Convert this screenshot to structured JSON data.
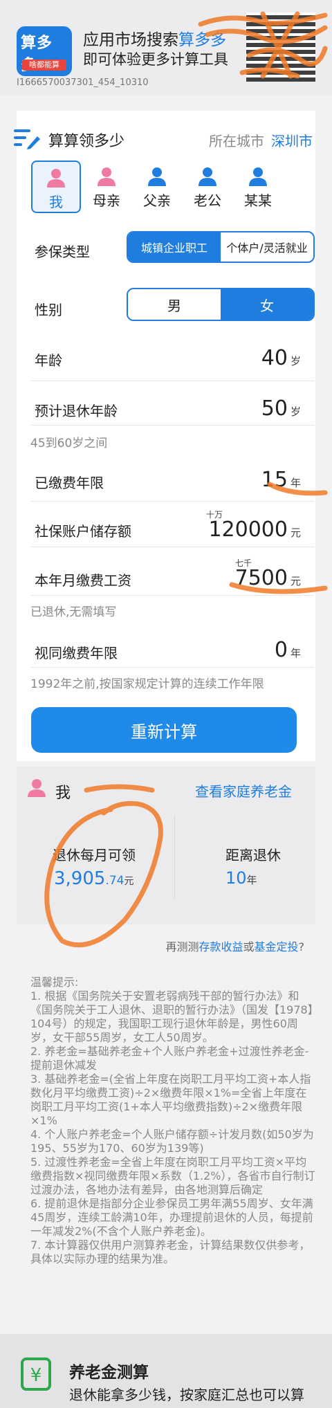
{
  "banner": {
    "title_prefix": "应用市场搜索",
    "title_highlight": "算多多",
    "subtitle": "即可体验更多计算工具",
    "id": "I1666570037301_454_10310",
    "app_icon_text": "算多多",
    "app_icon_tag": "啥都能算"
  },
  "header": {
    "title": "算算领多少",
    "city_label": "所在城市",
    "city_value": "深圳市",
    "icon": "list-pen-icon"
  },
  "persons": [
    {
      "label": "我",
      "selected": true,
      "color": "#f07aa0"
    },
    {
      "label": "母亲",
      "selected": false,
      "color": "#f07aa0"
    },
    {
      "label": "父亲",
      "selected": false,
      "color": "#1f7de0"
    },
    {
      "label": "老公",
      "selected": false,
      "color": "#1f7de0"
    },
    {
      "label": "某某",
      "selected": false,
      "color": "#1f7de0"
    }
  ],
  "form": {
    "insurance_type": {
      "label": "参保类型",
      "options": [
        "城镇企业职工",
        "个体户/灵活就业"
      ],
      "selected": 0
    },
    "gender": {
      "label": "性别",
      "options": [
        "男",
        "女"
      ],
      "selected": 1
    },
    "age": {
      "label": "年龄",
      "value": "40",
      "unit": "岁"
    },
    "retire_age": {
      "label": "预计退休年龄",
      "value": "50",
      "unit": "岁",
      "hint": "45到60岁之间"
    },
    "paid_years": {
      "label": "已缴费年限",
      "value": "15",
      "unit": "年"
    },
    "account_balance": {
      "label": "社保账户储存额",
      "value": "120000",
      "unit": "元",
      "magnitude": "十万"
    },
    "monthly_wage": {
      "label": "本年月缴费工资",
      "value": "7500",
      "unit": "元",
      "magnitude": "七千",
      "hint": "已退休,无需填写"
    },
    "deemed_years": {
      "label": "视同缴费年限",
      "value": "0",
      "unit": "年",
      "hint": "1992年之前,按国家规定计算的连续工作年限"
    }
  },
  "recalc_button": "重新计算",
  "result": {
    "name": "我",
    "family_link": "查看家庭养老金",
    "monthly_label": "退休每月可领",
    "monthly_value": "3,905",
    "monthly_decimal": ".74",
    "monthly_unit": "元",
    "distance_label": "距离退休",
    "distance_value": "10",
    "distance_unit": "年"
  },
  "more": {
    "prefix": "再测测",
    "link1": "存款收益",
    "mid": "或",
    "link2": "基金定投",
    "suffix": "?"
  },
  "tips": {
    "title": "温馨提示:",
    "items": [
      "1. 根据《国务院关于安置老弱病残干部的暂行办法》和《国务院关于工人退休、退职的暂行办法》（国发【1978】104号）的规定，我国职工现行退休年龄是，男性60周岁，女干部55周岁，女工人50周岁。",
      "2. 养老金=基础养老金+个人账户养老金+过渡性养老金-提前退休减发",
      "3. 基础养老金=(全省上年度在岗职工月平均工资+本人指数化月平均缴费工资)÷2×缴费年限×1%=全省上年度在岗职工月平均工资(1+本人平均缴费指数)÷2×缴费年限×1%",
      "4. 个人账户养老金=个人账户储存额÷计发月数(如50岁为195、55岁为170、60岁为139等)",
      "5. 过渡性养老金=全省上年度在岗职工月平均工资×平均缴费指数×视同缴费年限×系数（1.2%），各省市自行制订过渡办法，各地办法有差异，由各地测算后确定",
      "6. 提前退休是指部分企业参保员工男年满55周岁、女年满45周岁，连续工龄满10年，办理提前退休的人员，每提前一年减发2%(不含个人账户养老金)。",
      "7. 本计算器仅供用户测算养老金，计算结果数仅供参考，具体以实际办理的结果为准。"
    ]
  },
  "footer": {
    "title": "养老金测算",
    "subtitle": "退休能拿多少钱，按家庭汇总也可以算",
    "icon": "pension-calculator-icon"
  },
  "colors": {
    "accent": "#1f7de0",
    "pink": "#f07aa0",
    "scribble": "#f07a28"
  }
}
